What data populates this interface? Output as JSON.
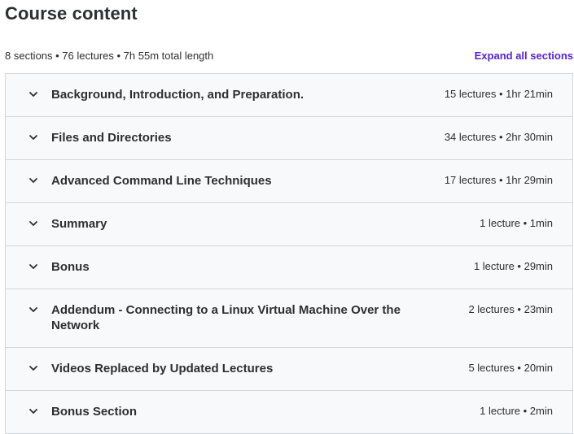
{
  "header": {
    "title": "Course content",
    "summary": "8 sections • 76 lectures • 7h 55m total length",
    "expand_label": "Expand all sections"
  },
  "colors": {
    "accent": "#5624d0",
    "section_bg": "#f7f9fa",
    "border": "#d1d7dc",
    "text": "#2d2f31"
  },
  "sections": [
    {
      "title": "Background, Introduction, and Preparation.",
      "meta": "15 lectures • 1hr 21min",
      "icon": "chevron-down-icon"
    },
    {
      "title": "Files and Directories",
      "meta": "34 lectures • 2hr 30min",
      "icon": "chevron-down-icon"
    },
    {
      "title": "Advanced Command Line Techniques",
      "meta": "17 lectures • 1hr 29min",
      "icon": "chevron-down-icon"
    },
    {
      "title": "Summary",
      "meta": "1 lecture • 1min",
      "icon": "chevron-down-icon"
    },
    {
      "title": "Bonus",
      "meta": "1 lecture • 29min",
      "icon": "chevron-down-icon"
    },
    {
      "title": "Addendum - Connecting to a Linux Virtual Machine Over the Network",
      "meta": "2 lectures • 23min",
      "icon": "chevron-down-icon"
    },
    {
      "title": "Videos Replaced by Updated Lectures",
      "meta": "5 lectures • 20min",
      "icon": "chevron-down-icon"
    },
    {
      "title": "Bonus Section",
      "meta": "1 lecture • 2min",
      "icon": "chevron-down-icon"
    }
  ]
}
